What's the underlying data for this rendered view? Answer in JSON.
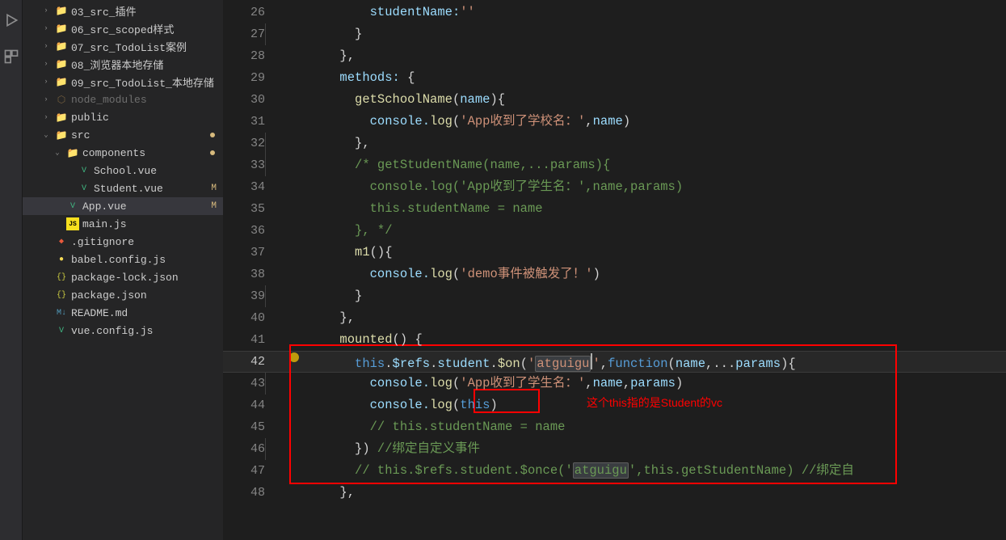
{
  "sidebar": {
    "items": [
      {
        "label": "03_src_插件",
        "type": "folder",
        "chevron": ">",
        "indent": 1
      },
      {
        "label": "06_src_scoped样式",
        "type": "folder",
        "chevron": ">",
        "indent": 1
      },
      {
        "label": "07_src_TodoList案例",
        "type": "folder",
        "chevron": ">",
        "indent": 1
      },
      {
        "label": "08_浏览器本地存储",
        "type": "folder",
        "chevron": ">",
        "indent": 1
      },
      {
        "label": "09_src_TodoList_本地存储",
        "type": "folder",
        "chevron": ">",
        "indent": 1
      },
      {
        "label": "node_modules",
        "type": "folder-dim",
        "chevron": ">",
        "indent": 1,
        "dimmed": true
      },
      {
        "label": "public",
        "type": "folder",
        "chevron": ">",
        "indent": 1
      },
      {
        "label": "src",
        "type": "folder",
        "chevron": "v",
        "indent": 1,
        "dot": true
      },
      {
        "label": "components",
        "type": "folder",
        "chevron": "v",
        "indent": 2,
        "dot": true
      },
      {
        "label": "School.vue",
        "type": "vue",
        "indent": 3
      },
      {
        "label": "Student.vue",
        "type": "vue",
        "indent": 3,
        "modified": "M"
      },
      {
        "label": "App.vue",
        "type": "vue",
        "indent": 2,
        "modified": "M",
        "active": true
      },
      {
        "label": "main.js",
        "type": "js",
        "indent": 2
      },
      {
        "label": ".gitignore",
        "type": "git",
        "indent": 1
      },
      {
        "label": "babel.config.js",
        "type": "babel",
        "indent": 1
      },
      {
        "label": "package-lock.json",
        "type": "json",
        "indent": 1
      },
      {
        "label": "package.json",
        "type": "json",
        "indent": 1
      },
      {
        "label": "README.md",
        "type": "md",
        "indent": 1
      },
      {
        "label": "vue.config.js",
        "type": "vue",
        "indent": 1
      }
    ]
  },
  "editor": {
    "lineStart": 26,
    "currentLine": 42,
    "annotation": "这个this指的是Student的vc",
    "code": {
      "l26": {
        "t1": "studentName:",
        "s1": "''"
      },
      "l27": {
        "t1": "}"
      },
      "l28": {
        "t1": "},"
      },
      "l29": {
        "t1": "methods:",
        "t2": " {"
      },
      "l30": {
        "fn": "getSchoolName",
        "t1": "(",
        "p1": "name",
        "t2": "){"
      },
      "l31": {
        "t1": "console.",
        "fn": "log",
        "t2": "(",
        "s1": "'App收到了学校名：'",
        "t3": ",",
        "p1": "name",
        "t4": ")"
      },
      "l32": {
        "t1": "},"
      },
      "l33": {
        "c1": "/* getStudentName(name,...params){"
      },
      "l34": {
        "c1": "  console.log('App收到了学生名：',name,params)"
      },
      "l35": {
        "c1": "  this.studentName = name"
      },
      "l36": {
        "c1": "}, */"
      },
      "l37": {
        "fn": "m1",
        "t1": "(){"
      },
      "l38": {
        "t1": "console.",
        "fn": "log",
        "t2": "(",
        "s1": "'demo事件被触发了！'",
        "t3": ")"
      },
      "l39": {
        "t1": "}"
      },
      "l40": {
        "t1": "},"
      },
      "l41": {
        "fn": "mounted",
        "t1": "() {"
      },
      "l42": {
        "k1": "this",
        "t1": ".",
        "p1": "$refs",
        "t2": ".",
        "p2": "student",
        "t3": ".",
        "fn": "$on",
        "t4": "(",
        "s1": "'",
        "hw": "atguigu",
        "s2": "'",
        "t5": ",",
        "k2": "function",
        "t6": "(",
        "p3": "name",
        "t7": ",...",
        "p4": "params",
        "t8": "){"
      },
      "l43": {
        "t1": "console.",
        "fn": "log",
        "t2": "(",
        "s1": "'App收到了学生名：'",
        "t3": ",",
        "p1": "name",
        "t4": ",",
        "p2": "params",
        "t5": ")"
      },
      "l44": {
        "t1": "console.",
        "fn": "log",
        "t2": "(",
        "k1": "this",
        "t3": ")"
      },
      "l45": {
        "c1": "// this.studentName = name"
      },
      "l46": {
        "t1": "}) ",
        "c1": "//绑定自定义事件"
      },
      "l47": {
        "c1": "// this.$refs.student.$once('",
        "hw": "atguigu",
        "c2": "',this.getStudentName) //绑定自"
      },
      "l48": {
        "t1": "},"
      }
    }
  }
}
